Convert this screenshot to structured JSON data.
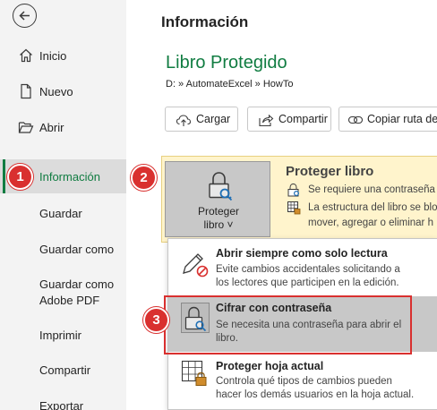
{
  "sidebar": {
    "back_icon": "back-arrow-icon",
    "items": [
      {
        "label": "Inicio",
        "icon": "home-icon"
      },
      {
        "label": "Nuevo",
        "icon": "new-document-icon"
      },
      {
        "label": "Abrir",
        "icon": "folder-open-icon"
      },
      {
        "label": "Información"
      },
      {
        "label": "Guardar"
      },
      {
        "label": "Guardar como"
      },
      {
        "label": "Guardar como\nAdobe PDF",
        "line1": "Guardar como",
        "line2": "Adobe PDF"
      },
      {
        "label": "Imprimir"
      },
      {
        "label": "Compartir"
      },
      {
        "label": "Exportar"
      }
    ],
    "active_color": "#107c41"
  },
  "callouts": [
    "1",
    "2",
    "3"
  ],
  "main": {
    "title": "Información",
    "book_title": "Libro Protegido",
    "path": "D: » AutomateExcel » HowTo",
    "actions": [
      {
        "label": "Cargar",
        "icon": "upload-icon"
      },
      {
        "label": "Compartir",
        "icon": "share-icon"
      },
      {
        "label": "Copiar ruta de a",
        "icon": "link-icon"
      }
    ]
  },
  "protect": {
    "button_line1": "Proteger",
    "button_line2": "libro ˅",
    "heading": "Proteger libro",
    "line1": "Se requiere una contraseña",
    "line2": "La estructura del libro se blo",
    "line3": "mover, agregar o eliminar h",
    "panel_color": "#fff4cc"
  },
  "dropdown": {
    "items": [
      {
        "title": "Abrir siempre como solo lectura",
        "desc1": "Evite cambios accidentales solicitando a",
        "desc2": "los lectores que participen en la edición.",
        "icon": "pencil-no-icon"
      },
      {
        "title": "Cifrar con contraseña",
        "desc1": "Se necesita una contraseña para abrir el",
        "desc2": "libro.",
        "icon": "lock-key-icon"
      },
      {
        "title": "Proteger hoja actual",
        "desc1": "Controla qué tipos de cambios pueden",
        "desc2": "hacer los demás usuarios en la hoja actual.",
        "icon": "sheet-lock-icon"
      }
    ],
    "highlight_color": "#d9302f"
  }
}
